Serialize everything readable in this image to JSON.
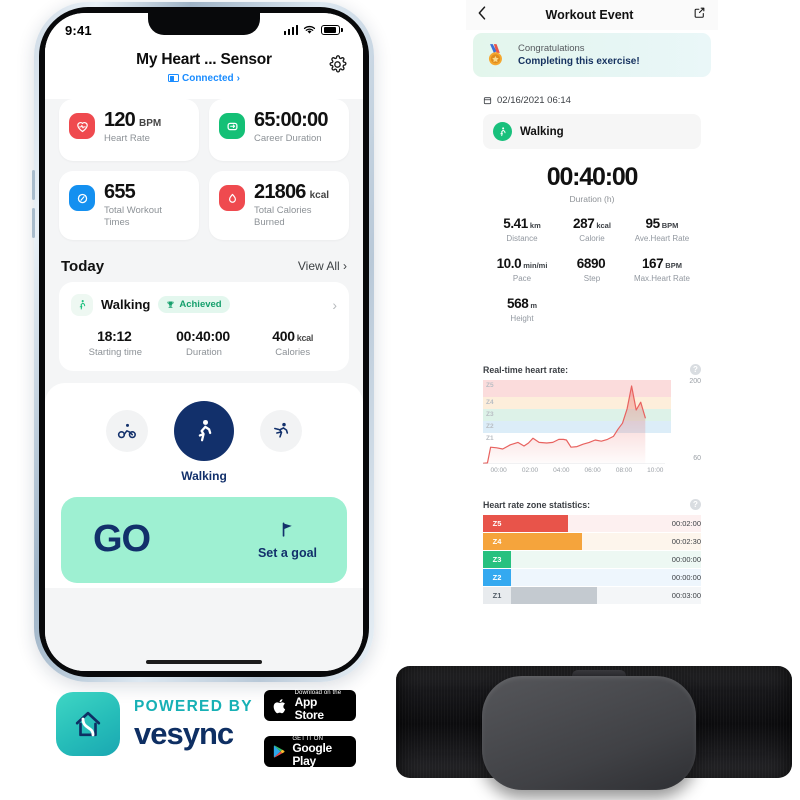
{
  "phone": {
    "status_bar": {
      "time": "9:41",
      "signal_icon": "signal-bars-icon",
      "wifi_icon": "wifi-icon",
      "battery_icon": "battery-icon"
    },
    "nav": {
      "back_icon": "chevron-left-icon",
      "title": "My Heart ... Sensor",
      "connection_status": "Connected",
      "connection_chevron": "›",
      "bluetooth_icon": "bluetooth-badge-icon",
      "settings_icon": "gear-icon"
    },
    "stat_cards": [
      {
        "icon": "heart-pulse-icon",
        "color": "#ef4a4f",
        "value": "120",
        "unit": "BPM",
        "label": "Heart Rate"
      },
      {
        "icon": "career-duration-icon",
        "color": "#14c076",
        "value": "65:00:00",
        "unit": "",
        "label": "Career Duration"
      },
      {
        "icon": "workout-times-icon",
        "color": "#1490f0",
        "value": "655",
        "unit": "",
        "label": "Total Workout Times"
      },
      {
        "icon": "flame-drop-icon",
        "color": "#ef4a4f",
        "value": "21806",
        "unit": "kcal",
        "label": "Total Calories Burned"
      }
    ],
    "today_section": {
      "title": "Today",
      "view_all": "View All ›"
    },
    "today_card": {
      "activity_icon": "walking-person-icon",
      "activity": "Walking",
      "badge_icon": "trophy-icon",
      "badge": "Achieved",
      "chevron": "›",
      "stats": [
        {
          "value": "18:12",
          "unit": "",
          "label": "Starting time"
        },
        {
          "value": "00:40:00",
          "unit": "",
          "label": "Duration"
        },
        {
          "value": "400",
          "unit": "kcal",
          "label": "Calories"
        }
      ]
    },
    "modes": [
      {
        "icon": "cycling-icon",
        "name": "Cycling",
        "active": false
      },
      {
        "icon": "walking-person-icon",
        "name": "Walking",
        "active": true
      },
      {
        "icon": "running-icon",
        "name": "Running",
        "active": false
      }
    ],
    "selected_mode_label": "Walking",
    "go_button": {
      "label": "GO",
      "goal_icon": "flag-icon",
      "goal_label": "Set a goal",
      "color": "#9ef0d2"
    }
  },
  "footer": {
    "logo_icon": "vesync-house-icon",
    "powered_by": "POWERED BY",
    "brand": "vesync",
    "stores": [
      {
        "id": "appstore",
        "icon": "apple-icon",
        "top": "Download on the",
        "bottom": "App Store"
      },
      {
        "id": "googleplay",
        "icon": "google-play-icon",
        "top": "GET IT ON",
        "bottom": "Google Play"
      }
    ]
  },
  "detail": {
    "nav": {
      "back_icon": "chevron-left-icon",
      "title": "Workout Event",
      "share_icon": "share-icon"
    },
    "congrats": {
      "icon": "medal-icon",
      "line1": "Congratulations",
      "line2": "Completing this exercise!"
    },
    "date": {
      "icon": "calendar-icon",
      "text": "02/16/2021 06:14"
    },
    "activity": {
      "icon": "walking-person-icon",
      "name": "Walking"
    },
    "duration": {
      "value": "00:40:00",
      "label": "Duration (h)"
    },
    "metrics": [
      {
        "value": "5.41",
        "unit": "km",
        "label": "Distance"
      },
      {
        "value": "287",
        "unit": "kcal",
        "label": "Calorie"
      },
      {
        "value": "95",
        "unit": "BPM",
        "label": "Ave.Heart Rate"
      },
      {
        "value": "10.0",
        "unit": "min/mi",
        "label": "Pace"
      },
      {
        "value": "6890",
        "unit": "",
        "label": "Step"
      },
      {
        "value": "167",
        "unit": "BPM",
        "label": "Max.Heart Rate"
      },
      {
        "value": "568",
        "unit": "m",
        "label": "Height"
      }
    ],
    "realtime": {
      "title": "Real-time heart rate:",
      "help_icon": "help-icon",
      "help_glyph": "?"
    },
    "zones": {
      "title": "Heart rate zone statistics:",
      "help_icon": "help-icon",
      "help_glyph": "?"
    }
  },
  "chart_data": [
    {
      "type": "area",
      "title": "Real-time heart rate:",
      "xlabel": "",
      "ylabel": "",
      "ylim": [
        60,
        200
      ],
      "ytick_labels": [
        "200",
        "60"
      ],
      "xtick_labels": [
        "00:00",
        "02:00",
        "04:00",
        "06:00",
        "08:00",
        "10:00"
      ],
      "line_color": "#e8625f",
      "grid": false,
      "zone_bands": [
        {
          "label": "Z5",
          "color": "#fbdcdc",
          "from": 172,
          "to": 200
        },
        {
          "label": "Z4",
          "color": "#fdeedb",
          "from": 152,
          "to": 172
        },
        {
          "label": "Z3",
          "color": "#ddf2e8",
          "from": 132,
          "to": 152
        },
        {
          "label": "Z2",
          "color": "#dcedf8",
          "from": 112,
          "to": 132
        },
        {
          "label": "Z1",
          "color": "#ffffff",
          "from": 60,
          "to": 112
        }
      ],
      "x": [
        0.0,
        0.3,
        0.5,
        0.9,
        1.3,
        1.8,
        2.3,
        2.7,
        3.0,
        3.3,
        3.7,
        4.2,
        4.6,
        5.0,
        5.3,
        5.5,
        5.8,
        6.2,
        6.6,
        7.0,
        7.4,
        7.8,
        8.2,
        8.6,
        8.9,
        9.2,
        9.5,
        9.8,
        10.1,
        10.4,
        10.7
      ],
      "values": [
        61,
        62,
        88,
        87,
        85,
        92,
        96,
        90,
        95,
        103,
        96,
        95,
        96,
        101,
        101,
        100,
        88,
        89,
        93,
        96,
        100,
        98,
        101,
        106,
        118,
        128,
        152,
        190,
        150,
        163,
        137
      ]
    },
    {
      "type": "bar",
      "orientation": "horizontal",
      "title": "Heart rate zone statistics:",
      "categories": [
        "Z5",
        "Z4",
        "Z3",
        "Z2",
        "Z1"
      ],
      "values": [
        120,
        150,
        0,
        0,
        180
      ],
      "value_labels": [
        "00:02:00",
        "00:02:30",
        "00:00:00",
        "00:00:00",
        "00:03:00"
      ],
      "bar_colors": [
        "#e8544a",
        "#f5a43c",
        "#27c17f",
        "#34a9f0",
        "#c4cad0"
      ],
      "tag_colors": [
        "#e8544a",
        "#f5a43c",
        "#27c17f",
        "#34a9f0",
        "#e8ebee"
      ],
      "track_colors": [
        "#fdf0f0",
        "#fdf5ec",
        "#edf8f3",
        "#eef6fd",
        "#f4f6f8"
      ],
      "tag_text_colors": [
        "#ffffff",
        "#ffffff",
        "#ffffff",
        "#ffffff",
        "#56606a"
      ],
      "ylabel": "",
      "xlabel": "",
      "grid": false
    }
  ]
}
